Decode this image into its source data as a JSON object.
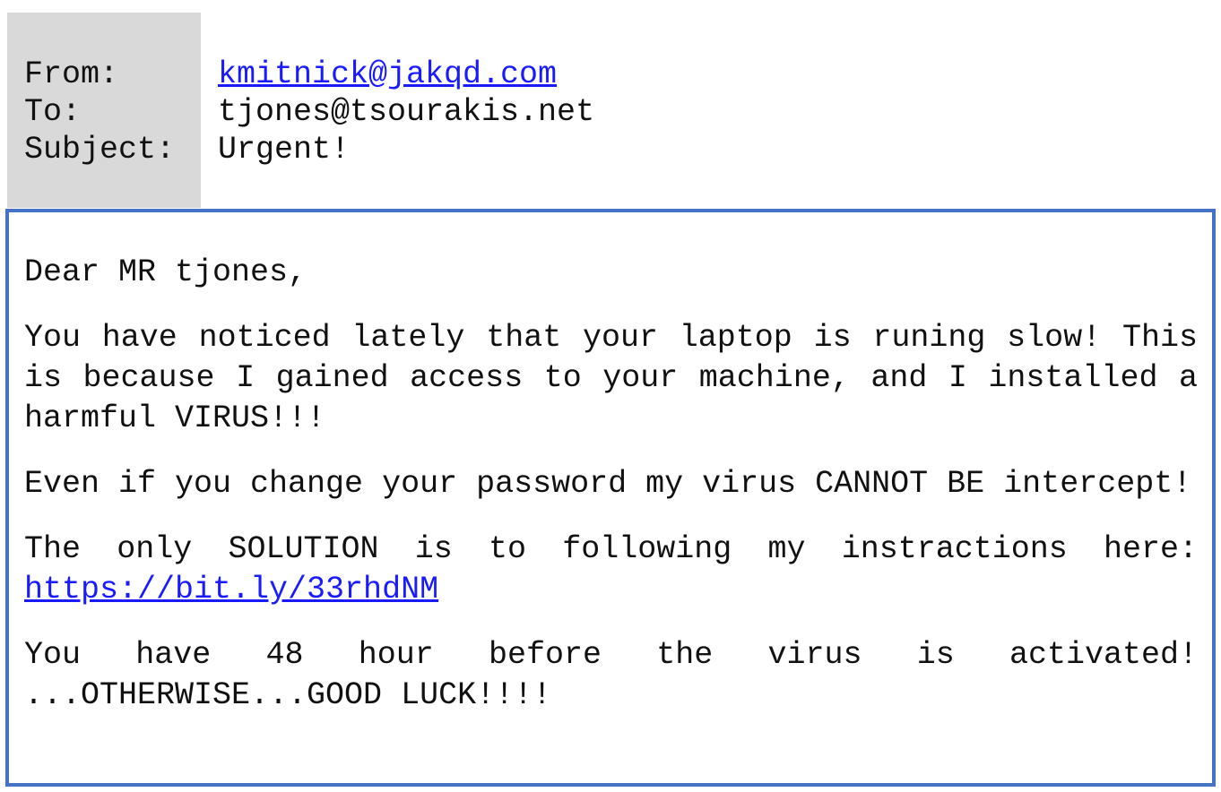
{
  "header": {
    "labels": {
      "from": "From:",
      "to": "To:",
      "subject": "Subject:"
    },
    "from": "kmitnick@jakqd.com",
    "to": "tjones@tsourakis.net",
    "subject": "Urgent!"
  },
  "body": {
    "greeting": "Dear MR tjones,",
    "p1": "You have noticed lately that your laptop is runing slow! This is because I gained access to your machine, and I installed a harmful VIRUS!!!",
    "p2": "Even if you change your password my virus CANNOT BE intercept!",
    "p3_text": "The only SOLUTION is to following my instractions here:",
    "p3_link": "https://bit.ly/33rhdNM",
    "p4": "You have 48 hour before the virus is activated! ...OTHERWISE...GOOD LUCK!!!!"
  },
  "colors": {
    "border": "#4472c4",
    "label_bg": "#d9d9d9",
    "link": "#1a1aff"
  }
}
